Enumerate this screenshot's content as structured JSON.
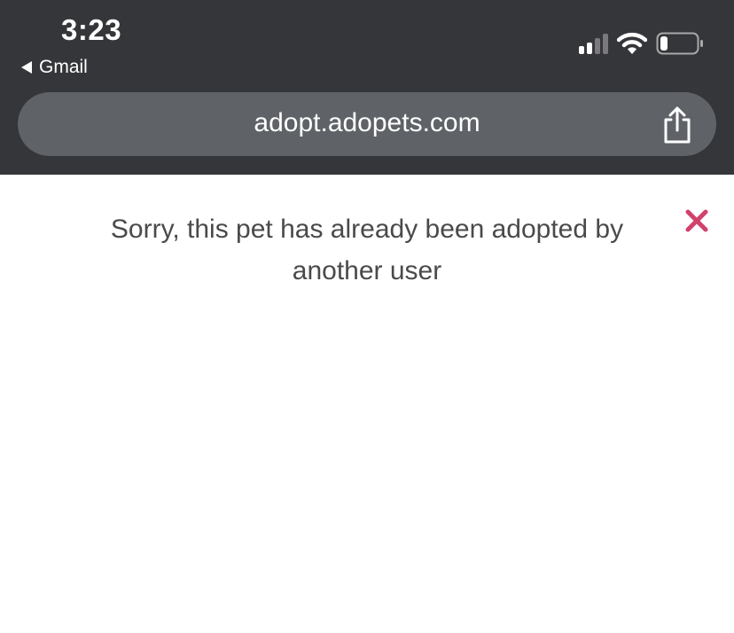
{
  "status_bar": {
    "time": "3:23",
    "back_app": "Gmail",
    "signal_icon": "cellular-signal-icon",
    "wifi_icon": "wifi-icon",
    "battery_icon": "battery-icon",
    "signal_active_bars": 2,
    "signal_total_bars": 4,
    "battery_level": 0.2
  },
  "url_bar": {
    "url": "adopt.adopets.com",
    "share_icon": "share-icon"
  },
  "alert": {
    "message": "Sorry, this pet has already been adopted by another user",
    "close_icon": "close-icon"
  },
  "colors": {
    "chrome_background": "#35363a",
    "url_bar_background": "#5f6368",
    "message_text": "#4a4a4a",
    "close_accent": "#d1416b"
  }
}
